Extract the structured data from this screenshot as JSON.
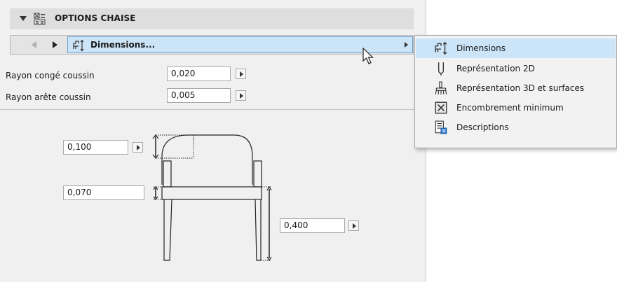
{
  "section": {
    "title": "OPTIONS CHAISE"
  },
  "nav": {
    "current_tab": "Dimensions..."
  },
  "params": [
    {
      "label": "Rayon congé coussin",
      "value": "0,020"
    },
    {
      "label": "Rayon arête coussin",
      "value": "0,005"
    }
  ],
  "diagram": {
    "cushion_height": "0,100",
    "seat_thickness": "0,070",
    "seat_height": "0,400"
  },
  "menu": {
    "items": [
      {
        "label": "Dimensions",
        "icon": "dimensions-icon",
        "selected": true
      },
      {
        "label": "Représentation 2D",
        "icon": "2d-representation-icon",
        "selected": false
      },
      {
        "label": "Représentation 3D et surfaces",
        "icon": "3d-surfaces-brush-icon",
        "selected": false
      },
      {
        "label": "Encombrement minimum",
        "icon": "minimum-space-icon",
        "selected": false
      },
      {
        "label": "Descriptions",
        "icon": "descriptions-icon",
        "selected": false
      }
    ]
  },
  "colors": {
    "panel_bg": "#f0f0f0",
    "selection_bg": "#cce4f7",
    "selection_border": "#6aa0d0"
  }
}
